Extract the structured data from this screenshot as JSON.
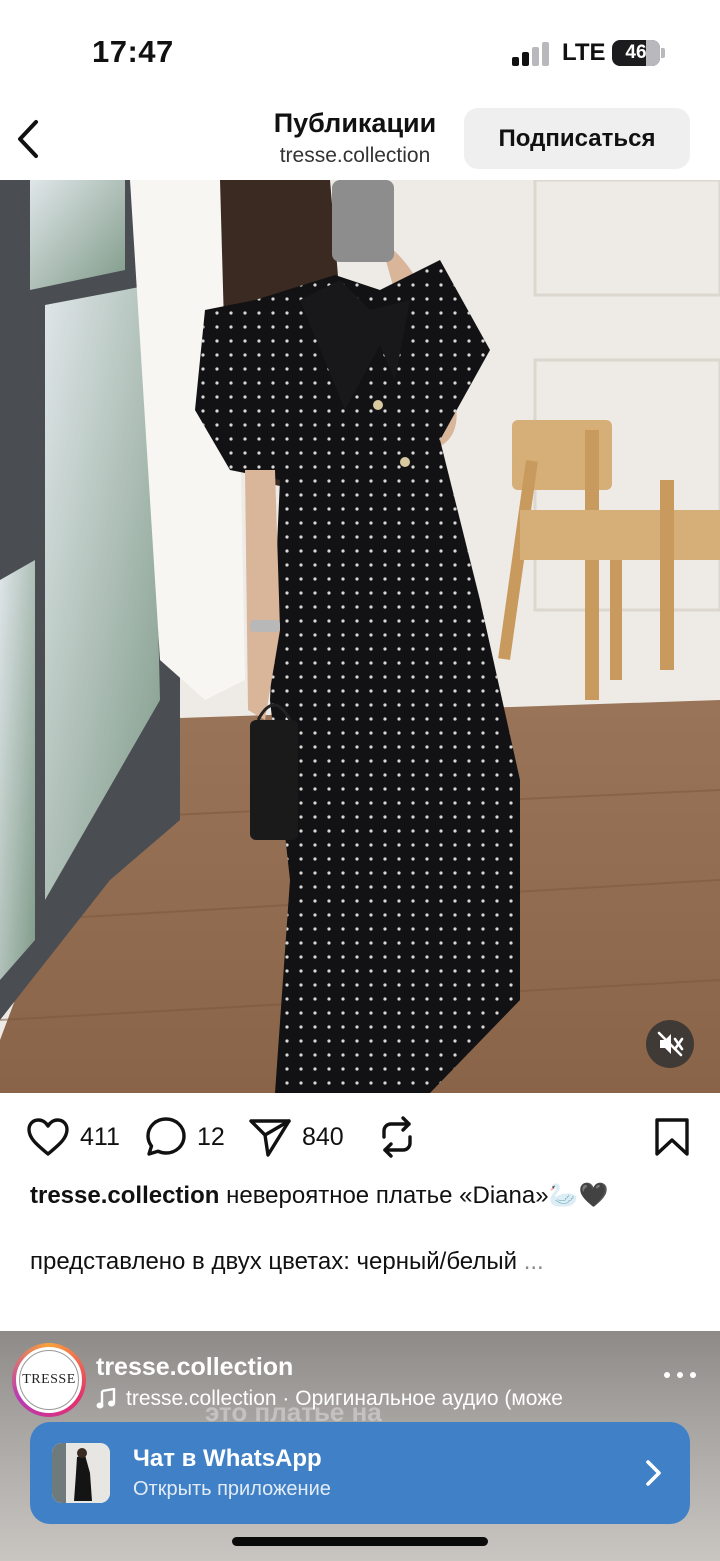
{
  "status_bar": {
    "time": "17:47",
    "network": "LTE",
    "battery": "46"
  },
  "header": {
    "back_icon": "chevron-left-icon",
    "title": "Публикации",
    "subtitle": "tresse.collection",
    "follow_label": "Подписаться"
  },
  "post": {
    "photo_description_icon": "photo",
    "mute_icon": "speaker-muted-icon",
    "actions": {
      "likes": "411",
      "comments": "12",
      "shares": "840"
    },
    "caption": {
      "username": "tresse.collection",
      "text": "невероятное платье «Diana»🦢🖤",
      "line2": "представлено в двух цветах: черный/белый",
      "more": "..."
    }
  },
  "next_post": {
    "avatar_text": "TRESSE",
    "username": "tresse.collection",
    "audio": "tresse.collection · Оригинальное аудио  (може",
    "overlay_text": "это платье на",
    "banner": {
      "title": "Чат в WhatsApp",
      "subtitle": "Открыть приложение"
    }
  },
  "colors": {
    "accent_banner": "#4080c6",
    "follow_bg": "#efefef"
  }
}
